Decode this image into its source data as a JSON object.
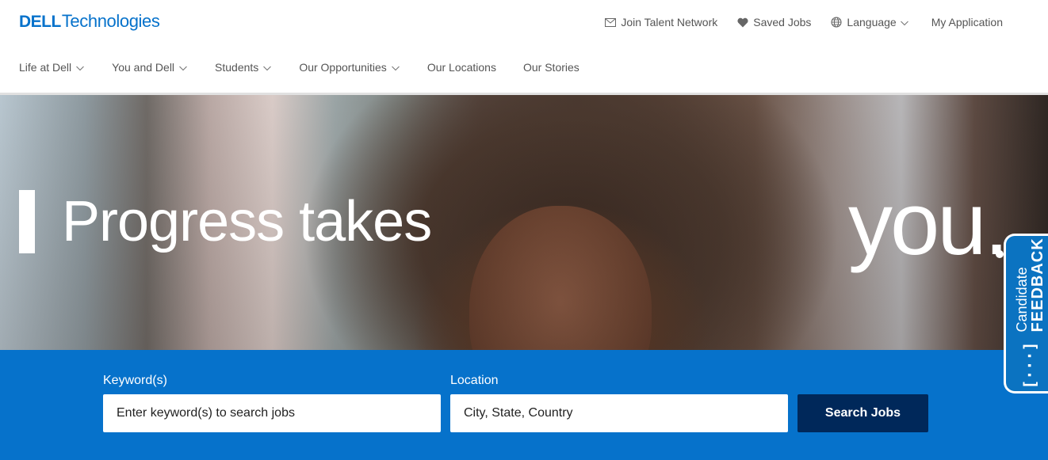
{
  "brand": {
    "logo_primary": "DELL",
    "logo_secondary": "Technologies",
    "color": "#0672cb"
  },
  "utility_nav": {
    "items": [
      {
        "label": "Join Talent Network",
        "icon": "envelope-icon"
      },
      {
        "label": "Saved Jobs",
        "icon": "heart-icon"
      },
      {
        "label": "Language",
        "icon": "globe-icon",
        "has_dropdown": true
      },
      {
        "label": "My Application"
      }
    ]
  },
  "main_nav": {
    "items": [
      {
        "label": "Life at Dell",
        "has_dropdown": true
      },
      {
        "label": "You and Dell",
        "has_dropdown": true
      },
      {
        "label": "Students",
        "has_dropdown": true
      },
      {
        "label": "Our Opportunities",
        "has_dropdown": true
      },
      {
        "label": "Our Locations",
        "has_dropdown": false
      },
      {
        "label": "Our Stories",
        "has_dropdown": false
      }
    ]
  },
  "hero": {
    "headline_left": "Progress takes",
    "headline_right": "you."
  },
  "search": {
    "keyword_label": "Keyword(s)",
    "keyword_placeholder": "Enter keyword(s) to search jobs",
    "keyword_value": "",
    "location_label": "Location",
    "location_placeholder": "City, State, Country",
    "location_value": "",
    "button_label": "Search Jobs",
    "band_color": "#0672cb",
    "button_color": "#00285a"
  },
  "feedback_tab": {
    "line1": "Candidate",
    "line2": "FEEDBACK",
    "icon_text": "[···]"
  }
}
